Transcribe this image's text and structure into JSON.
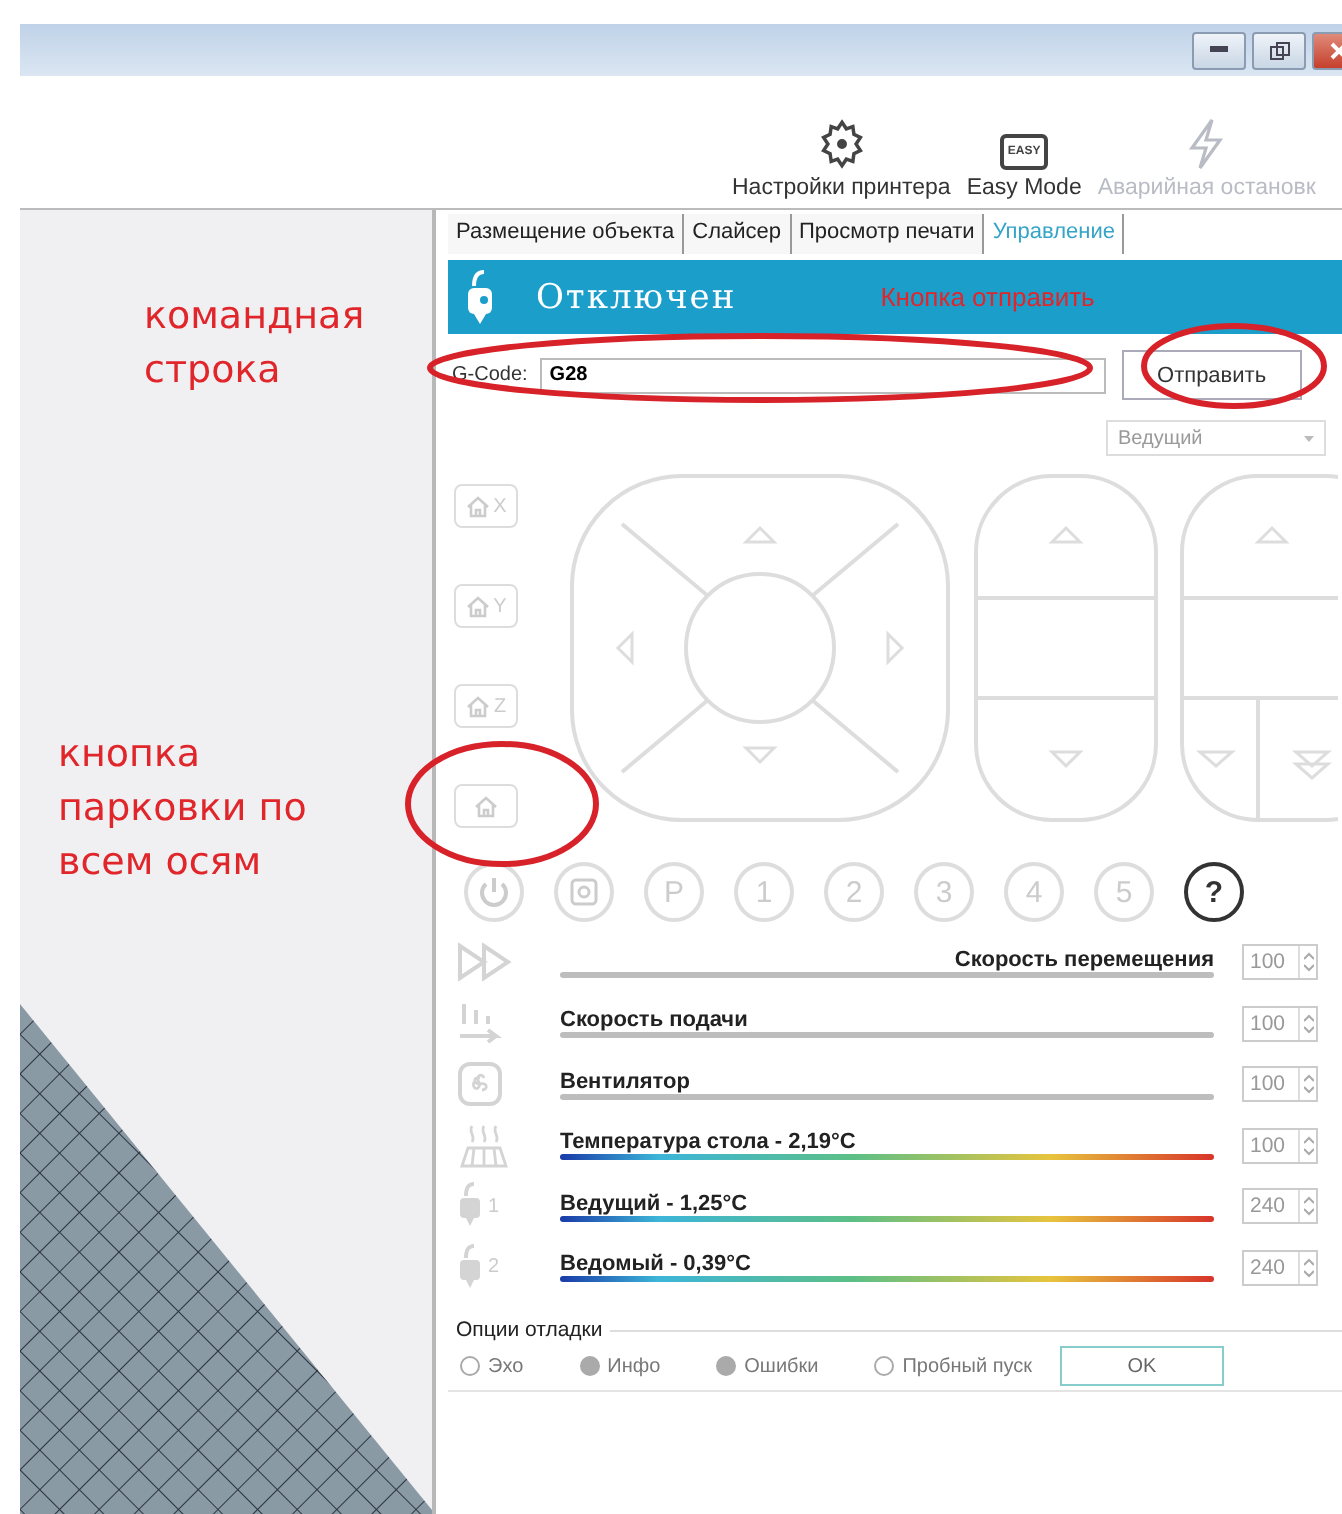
{
  "toolbar": [
    {
      "kind": "gear",
      "label": "Настройки принтера",
      "disabled": false
    },
    {
      "kind": "easy",
      "label": "Easy Mode",
      "icon_text": "EASY",
      "disabled": false
    },
    {
      "kind": "bolt",
      "label": "Аварийная остановк",
      "disabled": true
    }
  ],
  "tabs": [
    {
      "label": "Размещение объекта",
      "selected": false
    },
    {
      "label": "Слайсер",
      "selected": false
    },
    {
      "label": "Просмотр печати",
      "selected": false
    },
    {
      "label": "Управление",
      "selected": true
    }
  ],
  "annotations": [
    {
      "lines": [
        "командная",
        "строка"
      ]
    },
    {
      "lines": [
        "кнопка",
        "парковки по",
        "всем осям"
      ]
    }
  ],
  "printer": {
    "status": "Отключен",
    "annotation": "Кнопка отправить"
  },
  "gcode": {
    "label": "G-Code:",
    "value": "G28",
    "button": "Отправить"
  },
  "extruder_select": {
    "value": "Ведущий"
  },
  "home_buttons": [
    {
      "kind": "axis",
      "label": "X"
    },
    {
      "kind": "axis",
      "label": "Y"
    },
    {
      "kind": "axis",
      "label": "Z"
    },
    {
      "kind": "all"
    }
  ],
  "presets": [
    {
      "kind": "power"
    },
    {
      "kind": "camera"
    },
    {
      "kind": "text",
      "label": "P"
    },
    {
      "kind": "text",
      "label": "1"
    },
    {
      "kind": "text",
      "label": "2"
    },
    {
      "kind": "text",
      "label": "3"
    },
    {
      "kind": "text",
      "label": "4"
    },
    {
      "kind": "text",
      "label": "5"
    },
    {
      "kind": "help",
      "label": "?"
    }
  ],
  "sliders": [
    {
      "kind": "move",
      "label": "Скорость перемещения",
      "value": "100"
    },
    {
      "kind": "feed",
      "label": "Скорость подачи",
      "value": "100"
    },
    {
      "kind": "fan",
      "label": "Вентилятор",
      "value": "100"
    },
    {
      "kind": "bed",
      "label": "Температура стола - 2,19°C",
      "value": "100"
    },
    {
      "kind": "extruder",
      "icon_label": "1",
      "label": "Ведущий - 1,25°C",
      "value": "240"
    },
    {
      "kind": "extruder",
      "icon_label": "2",
      "label": "Ведомый - 0,39°C",
      "value": "240"
    }
  ],
  "debug": {
    "title": "Опции отладки",
    "options": [
      {
        "label": "Эхо",
        "checked": false
      },
      {
        "label": "Инфо",
        "checked": true
      },
      {
        "label": "Ошибки",
        "checked": true
      },
      {
        "label": "Пробный пуск",
        "checked": false
      }
    ],
    "ok": "OK"
  }
}
